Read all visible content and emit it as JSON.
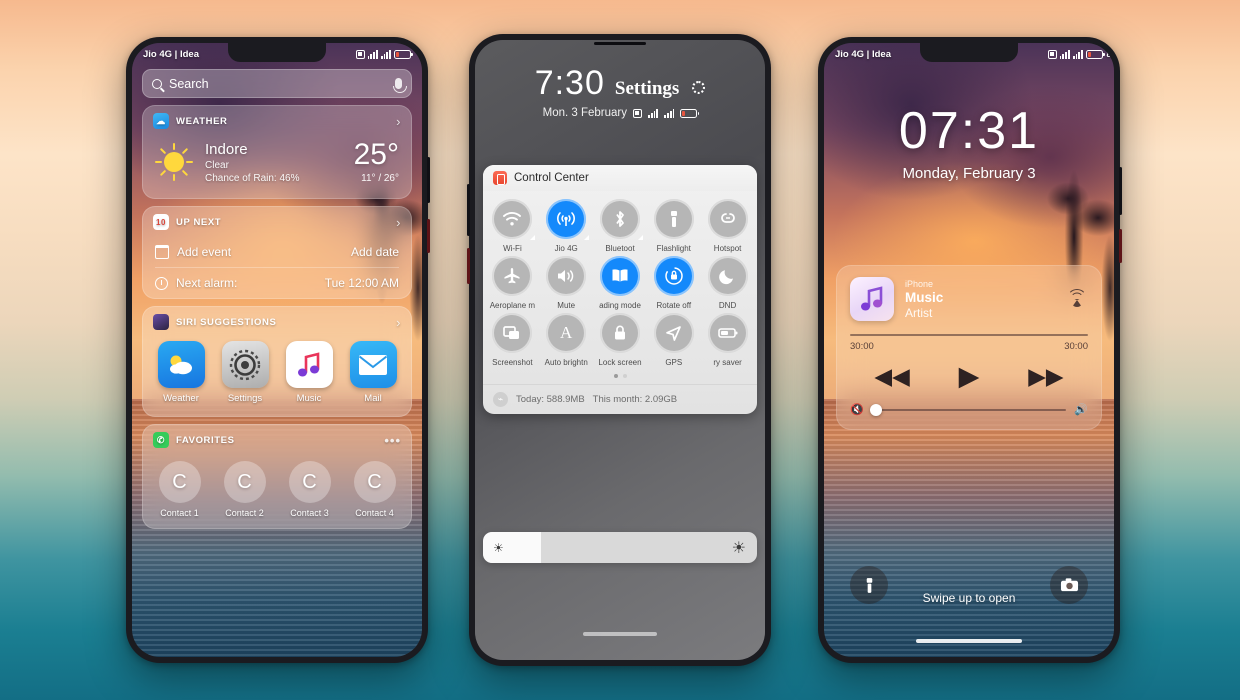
{
  "background": {
    "top_color": "#f6b98e",
    "bottom_color": "#136e85"
  },
  "phone1": {
    "status_bar": {
      "carrier": "Jio 4G | Idea",
      "battery_pct": "8"
    },
    "search": {
      "placeholder": "Search",
      "icon": "search-icon",
      "mic_icon": "microphone-icon"
    },
    "weather_widget": {
      "header": "WEATHER",
      "icon": "weather-icon",
      "city": "Indore",
      "condition": "Clear",
      "rain": "Chance of Rain: 46%",
      "temp": "25°",
      "high_low": "11° / 26°"
    },
    "up_next_widget": {
      "header": "UP NEXT",
      "icon": "calendar-icon",
      "event_label": "Add event",
      "event_action": "Add date",
      "alarm_label": "Next alarm:",
      "alarm_value": "Tue 12:00 AM"
    },
    "siri_widget": {
      "header": "SIRI SUGGESTIONS",
      "icon": "siri-icon",
      "apps": [
        {
          "label": "Weather",
          "icon": "weather-app-icon"
        },
        {
          "label": "Settings",
          "icon": "settings-app-icon"
        },
        {
          "label": "Music",
          "icon": "music-app-icon"
        },
        {
          "label": "Mail",
          "icon": "mail-app-icon"
        }
      ]
    },
    "favorites_widget": {
      "header": "FAVORITES",
      "icon": "phone-icon",
      "menu_icon": "more-icon",
      "contacts": [
        {
          "initial": "C",
          "label": "Contact 1"
        },
        {
          "initial": "C",
          "label": "Contact 2"
        },
        {
          "initial": "C",
          "label": "Contact 3"
        },
        {
          "initial": "C",
          "label": "Contact 4"
        }
      ]
    }
  },
  "phone2": {
    "clock": "7:30",
    "settings_label": "Settings",
    "gear_icon": "gear-icon",
    "date": "Mon. 3 February",
    "battery_pct": "8",
    "control_center": {
      "title": "Control Center",
      "icon": "control-center-icon",
      "toggles": [
        {
          "label": "Wi-Fi",
          "icon": "wifi-icon",
          "on": false,
          "expandable": true
        },
        {
          "label": "Jio 4G",
          "icon": "cellular-icon",
          "on": true,
          "expandable": true
        },
        {
          "label": "Bluetoot",
          "icon": "bluetooth-icon",
          "on": false,
          "expandable": true
        },
        {
          "label": "Flashlight",
          "icon": "flashlight-icon",
          "on": false,
          "expandable": false
        },
        {
          "label": "Hotspot",
          "icon": "hotspot-icon",
          "on": false,
          "expandable": false
        },
        {
          "label": "Aeroplane m",
          "icon": "airplane-icon",
          "on": false,
          "expandable": false
        },
        {
          "label": "Mute",
          "icon": "speaker-icon",
          "on": false,
          "expandable": false
        },
        {
          "label": "ading mode",
          "icon": "reading-mode-icon",
          "on": true,
          "expandable": false
        },
        {
          "label": "Rotate off",
          "icon": "rotation-lock-icon",
          "on": true,
          "expandable": false
        },
        {
          "label": "DND",
          "icon": "moon-icon",
          "on": false,
          "expandable": false
        },
        {
          "label": "Screenshot",
          "icon": "screenshot-icon",
          "on": false,
          "expandable": false
        },
        {
          "label": "Auto brightn",
          "icon": "auto-brightness-icon",
          "on": false,
          "expandable": false
        },
        {
          "label": "Lock screen",
          "icon": "lock-icon",
          "on": false,
          "expandable": false
        },
        {
          "label": "GPS",
          "icon": "location-icon",
          "on": false,
          "expandable": false
        },
        {
          "label": "ry saver",
          "icon": "battery-saver-icon",
          "on": false,
          "expandable": false
        }
      ],
      "page_dots": 2,
      "active_page": 0,
      "data_icon": "data-usage-icon",
      "data_today": "Today: 588.9MB",
      "data_month": "This month: 2.09GB"
    },
    "brightness": {
      "low_icon": "brightness-low-icon",
      "high_icon": "brightness-high-icon",
      "level_pct": 21
    }
  },
  "phone3": {
    "status_bar": {
      "carrier": "Jio 4G | Idea",
      "battery_pct": "8"
    },
    "clock": "07:31",
    "date": "Monday, February 3",
    "player": {
      "source": "iPhone",
      "title": "Music",
      "artist": "Artist",
      "art_icon": "music-note-icon",
      "airplay_icon": "airplay-icon",
      "time_elapsed": "30:00",
      "time_total": "30:00",
      "prev_icon": "rewind-icon",
      "play_icon": "play-icon",
      "next_icon": "fast-forward-icon",
      "vol_min_icon": "volume-mute-icon",
      "vol_max_icon": "volume-high-icon",
      "volume_pct": 0
    },
    "flashlight_icon": "flashlight-icon",
    "camera_icon": "camera-icon",
    "swipe_hint": "Swipe up to open"
  }
}
